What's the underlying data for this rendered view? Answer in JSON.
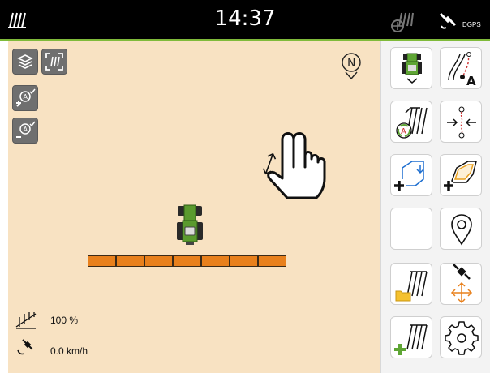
{
  "topbar": {
    "time": "14:37",
    "gps_label": "DGPS"
  },
  "map": {
    "compass_label": "N",
    "status": {
      "work_width": "100 %",
      "speed": "0.0 km/h"
    },
    "tractor_color": "#5a9a2e",
    "boom_color": "#e8801c",
    "boom_sections": 7
  },
  "map_buttons": [
    "layers-button",
    "fullscreen-button",
    "zoom-in-button",
    "zoom-out-button"
  ],
  "right_panel": {
    "tiles": [
      "tractor-view",
      "guidance-line-a",
      "headland-auto",
      "steering-offset",
      "add-boundary",
      "add-field-boundary",
      "empty",
      "location-pin",
      "field-folder",
      "gps-move",
      "add-field",
      "settings"
    ],
    "accent_green": "#5ea534",
    "accent_blue": "#1e6fd0"
  },
  "gesture": "pinch-drag-hand"
}
